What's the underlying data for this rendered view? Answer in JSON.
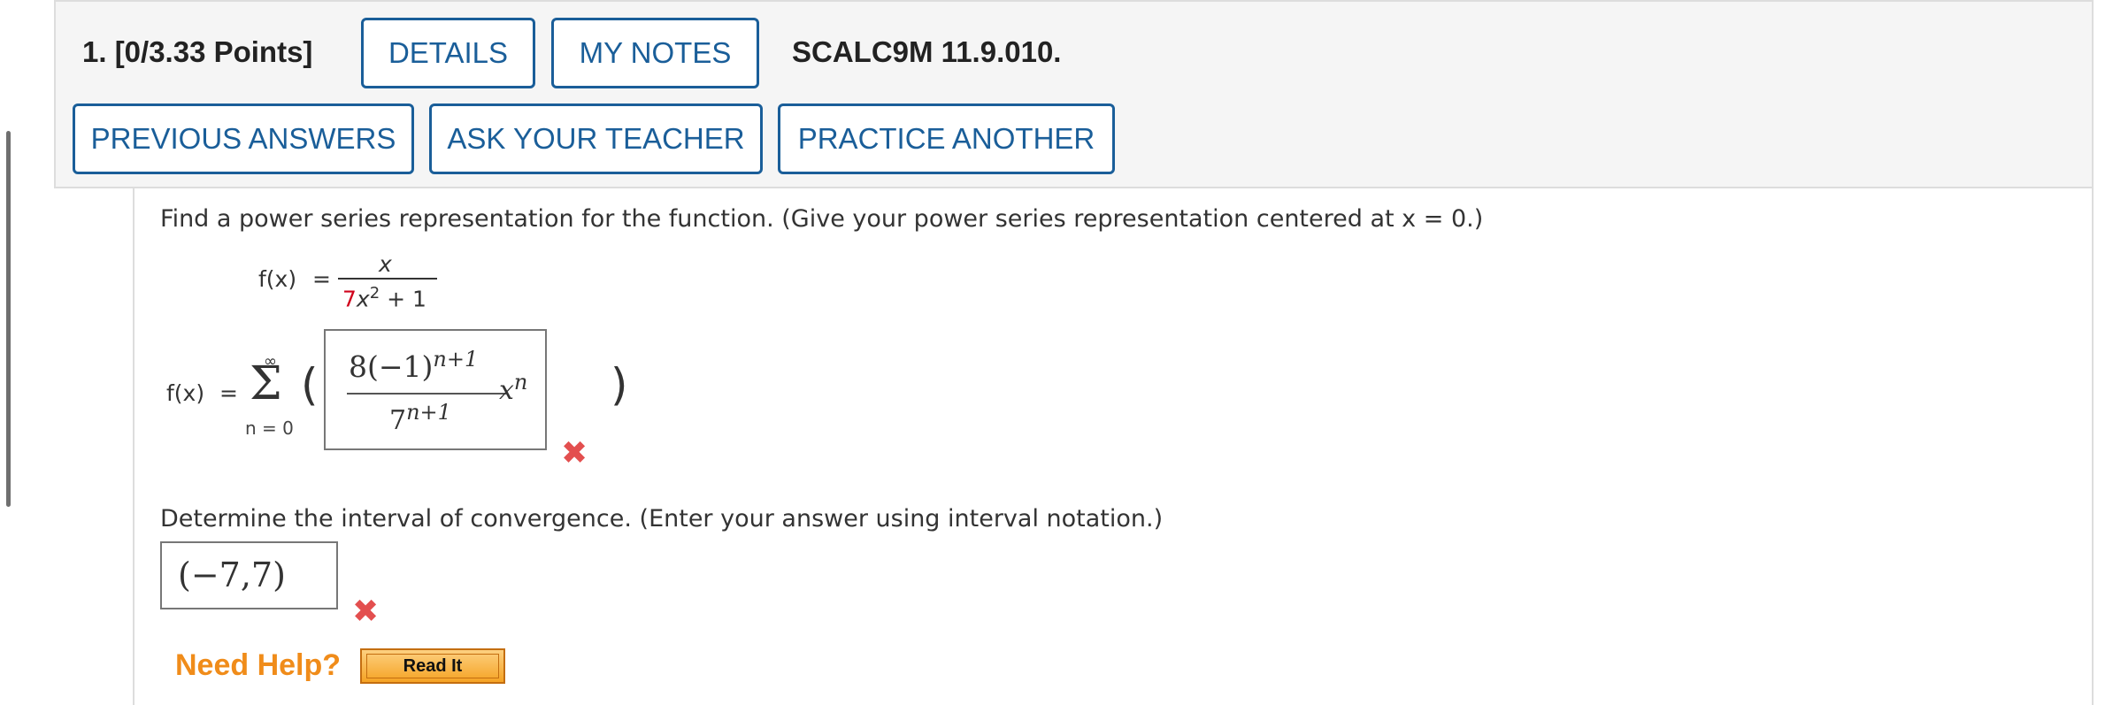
{
  "header": {
    "question_title": "1.  [0/3.33 Points]",
    "details_label": "DETAILS",
    "my_notes_label": "MY NOTES",
    "question_code": "SCALC9M 11.9.010.",
    "previous_answers_label": "PREVIOUS ANSWERS",
    "ask_teacher_label": "ASK YOUR TEACHER",
    "practice_another_label": "PRACTICE ANOTHER"
  },
  "problem": {
    "prompt_1": "Find a power series representation for the function. (Give your power series representation centered at x = 0.)",
    "func_lhs": "f(x)",
    "equals": "=",
    "numerator": "x",
    "denominator_coef": "7",
    "denominator_var": "x",
    "denominator_exp": "2",
    "denominator_tail": " + 1",
    "series_lhs": "f(x)",
    "sum_top": "∞",
    "sum_symbol": "Σ",
    "sum_bottom": "n = 0",
    "open_paren": "(",
    "close_paren": ")",
    "answer1": {
      "num_base": "8(−1)",
      "num_exp": "n+1",
      "den_base": "7",
      "den_exp": "n+1",
      "var": "x",
      "var_exp": "n"
    },
    "answer1_status": "incorrect",
    "prompt_2": "Determine the interval of convergence. (Enter your answer using interval notation.)",
    "answer2": "(−7,7)",
    "answer2_status": "incorrect"
  },
  "help": {
    "need_help_label": "Need Help?",
    "read_it_label": "Read It"
  },
  "icons": {
    "wrong_icon": "red-x-mark"
  },
  "colors": {
    "button_blue": "#1a5e99",
    "need_help_orange": "#f08c1a",
    "wrong_red": "#e34f4f",
    "highlight_red": "#d0021b"
  }
}
